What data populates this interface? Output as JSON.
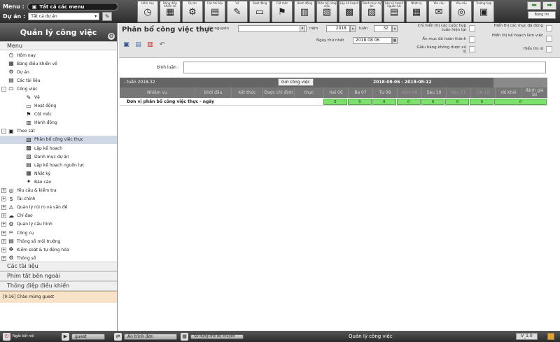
{
  "top": {
    "menu_label": "Menu :",
    "menu_value": "Tất cả các menu",
    "project_label": "Dự án :",
    "project_value": "Tất cả dự án"
  },
  "toolbar": [
    {
      "label": "Hôm nay",
      "icon": "clock-icon",
      "glyph": "◷"
    },
    {
      "label": "Bảng điều khiển về",
      "icon": "dashboard-icon",
      "glyph": "▦"
    },
    {
      "label": "Dự án",
      "icon": "gear-icon",
      "glyph": "⚙"
    },
    {
      "label": "Các tài liệu",
      "icon": "document-icon",
      "glyph": "▤"
    },
    {
      "label": "Về",
      "icon": "pencil-icon",
      "glyph": "✎"
    },
    {
      "label": "Hoạt động",
      "icon": "monitor-icon",
      "glyph": "▭"
    },
    {
      "label": "Cột mốc",
      "icon": "flag-icon",
      "glyph": "⚑"
    },
    {
      "label": "Hành động",
      "icon": "clapper-icon",
      "glyph": "▥"
    },
    {
      "label": "Phân bổ công việc",
      "icon": "allocation-icon",
      "glyph": "▧"
    },
    {
      "label": "Lập kế hoạch",
      "icon": "calendar-icon",
      "glyph": "▩"
    },
    {
      "label": "Danh mục dự án",
      "icon": "portfolio-icon",
      "glyph": "▨"
    },
    {
      "label": "Lập kế hoạch nguồn lực",
      "icon": "resource-icon",
      "glyph": "▤"
    },
    {
      "label": "Nhật ký",
      "icon": "diary-icon",
      "glyph": "▦"
    },
    {
      "label": "Yêu cầu",
      "icon": "request-icon",
      "glyph": "✉"
    },
    {
      "label": "Yêu cầu",
      "icon": "target-icon",
      "glyph": "◎"
    },
    {
      "label": "Trường hợp",
      "icon": "case-icon",
      "glyph": "▣"
    }
  ],
  "nav": {
    "back": "⬅",
    "forward": "➡",
    "help": "Bảng tin"
  },
  "sidebar": {
    "title": "Quản lý công việc",
    "menu_section": "Menu",
    "items": [
      {
        "label": "Hôm nay",
        "icon": "clock-icon",
        "glyph": "◷",
        "level": 0,
        "toggle": ""
      },
      {
        "label": "Bảng điều khiển về",
        "icon": "dashboard-icon",
        "glyph": "▦",
        "level": 0,
        "toggle": ""
      },
      {
        "label": "Dự án",
        "icon": "gear-icon",
        "glyph": "⚙",
        "level": 0,
        "toggle": ""
      },
      {
        "label": "Các tài liệu",
        "icon": "document-icon",
        "glyph": "▤",
        "level": 0,
        "toggle": ""
      },
      {
        "label": "Công việc",
        "icon": "monitor-icon",
        "glyph": "▭",
        "level": 0,
        "toggle": "-"
      },
      {
        "label": "Về",
        "icon": "pencil-icon",
        "glyph": "✎",
        "level": 1,
        "toggle": ""
      },
      {
        "label": "Hoạt động",
        "icon": "monitor-icon",
        "glyph": "▭",
        "level": 1,
        "toggle": ""
      },
      {
        "label": "Cột mốc",
        "icon": "flag-icon",
        "glyph": "⚑",
        "level": 1,
        "toggle": ""
      },
      {
        "label": "Hành động",
        "icon": "clapper-icon",
        "glyph": "▥",
        "level": 1,
        "toggle": ""
      },
      {
        "label": "Theo sát",
        "icon": "follow-icon",
        "glyph": "▣",
        "level": 0,
        "toggle": "-"
      },
      {
        "label": "Phân bổ công việc thực",
        "icon": "allocation-icon",
        "glyph": "▧",
        "level": 1,
        "toggle": "",
        "selected": true
      },
      {
        "label": "Lập kế hoạch",
        "icon": "calendar-icon",
        "glyph": "▩",
        "level": 1,
        "toggle": ""
      },
      {
        "label": "Danh mục dự án",
        "icon": "portfolio-icon",
        "glyph": "▨",
        "level": 1,
        "toggle": ""
      },
      {
        "label": "Lập kế hoạch nguồn lực",
        "icon": "resource-icon",
        "glyph": "▤",
        "level": 1,
        "toggle": ""
      },
      {
        "label": "Nhật ký",
        "icon": "diary-icon",
        "glyph": "▦",
        "level": 1,
        "toggle": ""
      },
      {
        "label": "Báo cáo",
        "icon": "report-icon",
        "glyph": "✦",
        "level": 1,
        "toggle": ""
      },
      {
        "label": "Yêu cầu & kiểm tra",
        "icon": "request-icon",
        "glyph": "◎",
        "level": 0,
        "toggle": "+"
      },
      {
        "label": "Tài chính",
        "icon": "money-icon",
        "glyph": "$",
        "level": 0,
        "toggle": "+"
      },
      {
        "label": "Quản lý rủi ro và vấn đề",
        "icon": "warning-icon",
        "glyph": "⚠",
        "level": 0,
        "toggle": "+"
      },
      {
        "label": "Chỉ đạo",
        "icon": "steering-icon",
        "glyph": "☁",
        "level": 0,
        "toggle": "+"
      },
      {
        "label": "Quản lý cấu hình",
        "icon": "config-icon",
        "glyph": "⚙",
        "level": 0,
        "toggle": "+"
      },
      {
        "label": "Công cụ",
        "icon": "tools-icon",
        "glyph": "✂",
        "level": 0,
        "toggle": "+"
      },
      {
        "label": "Thông số môi trường",
        "icon": "environment-icon",
        "glyph": "▤",
        "level": 0,
        "toggle": "+"
      },
      {
        "label": "Kiểm soát & tự động hóa",
        "icon": "automation-icon",
        "glyph": "✥",
        "level": 0,
        "toggle": "+"
      },
      {
        "label": "Thông số",
        "icon": "parameters-icon",
        "glyph": "⚙",
        "level": 0,
        "toggle": "+"
      }
    ],
    "bottom_sections": [
      "Các tài liệu",
      "Phím tắt bên ngoài",
      "Thông điệp điều khiển"
    ],
    "welcome": "[9:16] Chào mừng guest"
  },
  "main": {
    "title": "Phân bổ công việc thực",
    "resource_label": "Tài nguyên",
    "resource_value": "",
    "year_label": "năm",
    "year_value": "2018",
    "week_label": "tuần",
    "week_value": "32",
    "first_day_label": "Ngày thứ nhất",
    "first_day_value": "2018 08 06",
    "options": [
      "Chỉ hiển thị các cuộc họp tuần hiện tại",
      "Ẩn mục đã hoàn thành",
      "Giấu hàng không được xử lý",
      "Hiển thị các mục đã đóng",
      "Hiển thị kế hoạch làm việc",
      "Hiển thị id"
    ],
    "comment_label": "bình luận :",
    "comment_value": ""
  },
  "grid": {
    "week": "- tuần 2018-32",
    "send_button": "Gửi công việc",
    "range": "2018-08-06 - 2018-08-12",
    "columns": [
      {
        "label": "Nhiệm vụ",
        "w": 108,
        "dim": false
      },
      {
        "label": "khởi đầu",
        "w": 52,
        "dim": false
      },
      {
        "label": "kết thúc",
        "w": 45,
        "dim": false
      },
      {
        "label": "Được chỉ định",
        "w": 45,
        "dim": false
      },
      {
        "label": "thực",
        "w": 42,
        "dim": false
      },
      {
        "label": "Hai 06",
        "w": 35,
        "dim": false
      },
      {
        "label": "Ba 07",
        "w": 35,
        "dim": false
      },
      {
        "label": "Tư 08",
        "w": 35,
        "dim": false
      },
      {
        "label": "năm 09",
        "w": 35,
        "dim": true
      },
      {
        "label": "Sáu 10",
        "w": 35,
        "dim": false
      },
      {
        "label": "Bảy 11",
        "w": 35,
        "dim": true
      },
      {
        "label": "CN 12",
        "w": 35,
        "dim": true
      },
      {
        "label": "rời khỏi",
        "w": 38,
        "dim": false
      },
      {
        "label": "đánh giá lại",
        "w": 36,
        "dim": false
      }
    ],
    "row": {
      "name": "Đơn vị phân bổ công việc thực - ngày",
      "values": [
        "0",
        "0",
        "0",
        "0",
        "0",
        "0",
        "0",
        "0"
      ],
      "widths": [
        35,
        35,
        35,
        35,
        35,
        35,
        35,
        76
      ]
    }
  },
  "statusbar": {
    "disconnect": "Ngắt kết nối",
    "user": "guest",
    "hide_menu": "Ẩn trình đơn",
    "full_screen": "Sử dụng chế độ chuyển",
    "app_name": "Quản lý công việc",
    "version": "V_1.0"
  }
}
